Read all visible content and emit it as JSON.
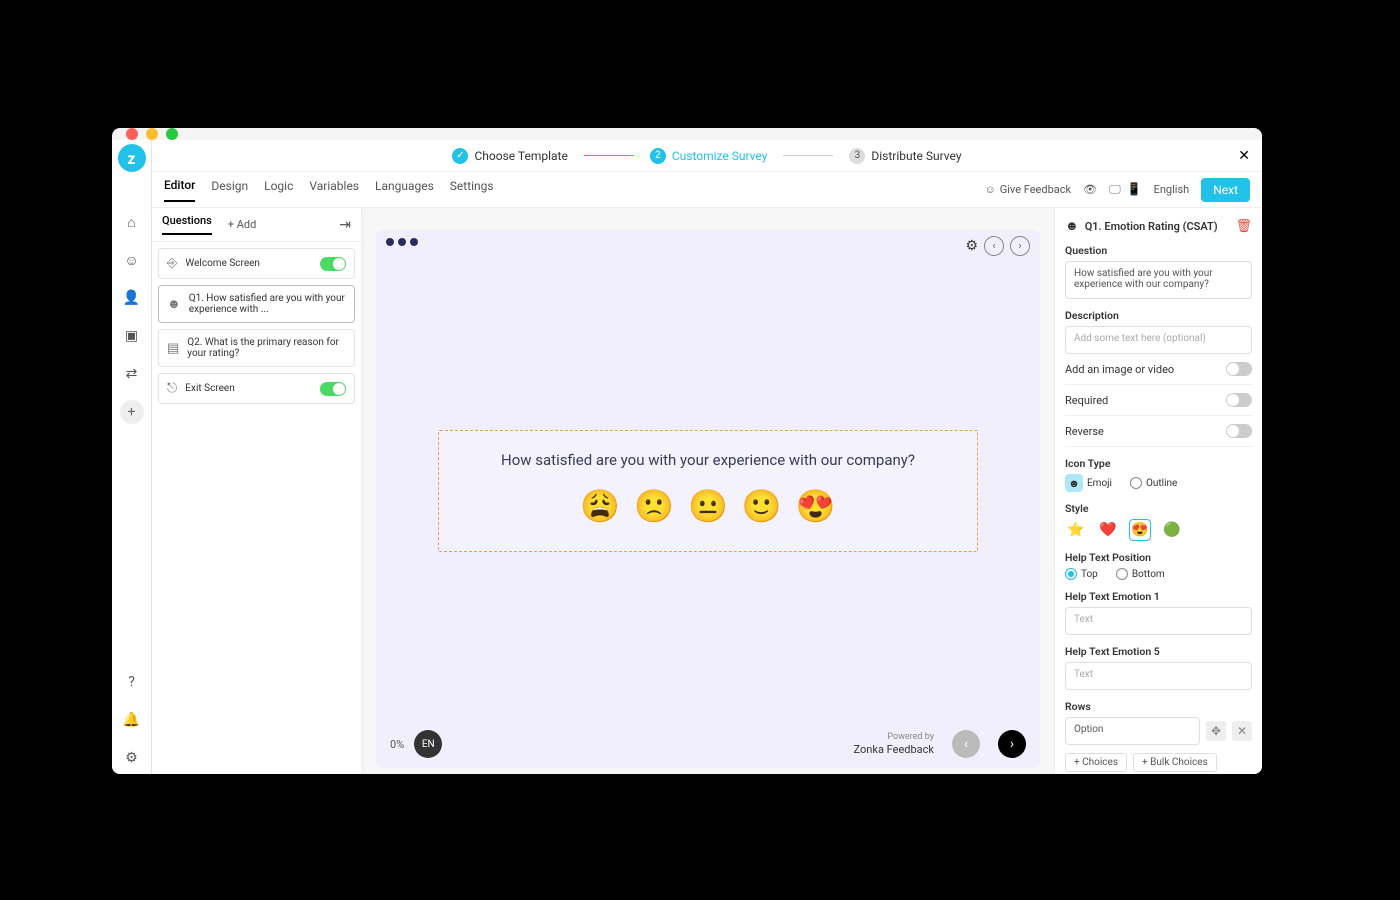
{
  "steps": {
    "s1": "Choose Template",
    "s2": "Customize Survey",
    "s3": "Distribute Survey",
    "n2": "2",
    "n3": "3"
  },
  "tabs": {
    "editor": "Editor",
    "design": "Design",
    "logic": "Logic",
    "variables": "Variables",
    "languages": "Languages",
    "settings": "Settings"
  },
  "toolbar": {
    "feedback": "Give Feedback",
    "language": "English",
    "next": "Next"
  },
  "sidebar": {
    "questions_tab": "Questions",
    "add": "+ Add",
    "items": {
      "welcome": "Welcome Screen",
      "q1": "Q1. How satisfied are you with your experience with ...",
      "q2": "Q2. What is the primary reason for your rating?",
      "exit": "Exit Screen"
    }
  },
  "canvas": {
    "question": "How satisfied are you with your experience with our company?",
    "emojis": [
      "😩",
      "🙁",
      "😐",
      "🙂",
      "😍"
    ],
    "progress": "0%",
    "lang": "EN",
    "powered_small": "Powered by",
    "powered_brand": "Zonka Feedback"
  },
  "panel": {
    "title": "Q1. Emotion Rating (CSAT)",
    "question_label": "Question",
    "question_value": "How satisfied are you with your experience with our company?",
    "description_label": "Description",
    "description_placeholder": "Add some text here (optional)",
    "add_media": "Add an image or video",
    "required": "Required",
    "reverse": "Reverse",
    "icon_type_label": "Icon Type",
    "icon_emoji": "Emoji",
    "icon_outline": "Outline",
    "style_label": "Style",
    "style_opts": [
      "⭐",
      "❤️",
      "😍",
      "🟢"
    ],
    "help_pos_label": "Help Text Position",
    "help_top": "Top",
    "help_bottom": "Bottom",
    "hte1_label": "Help Text Emotion 1",
    "hte5_label": "Help Text Emotion 5",
    "text_placeholder": "Text",
    "rows_label": "Rows",
    "rows_value": "Option",
    "choices_btn": "+ Choices",
    "bulk_btn": "+ Bulk Choices"
  }
}
